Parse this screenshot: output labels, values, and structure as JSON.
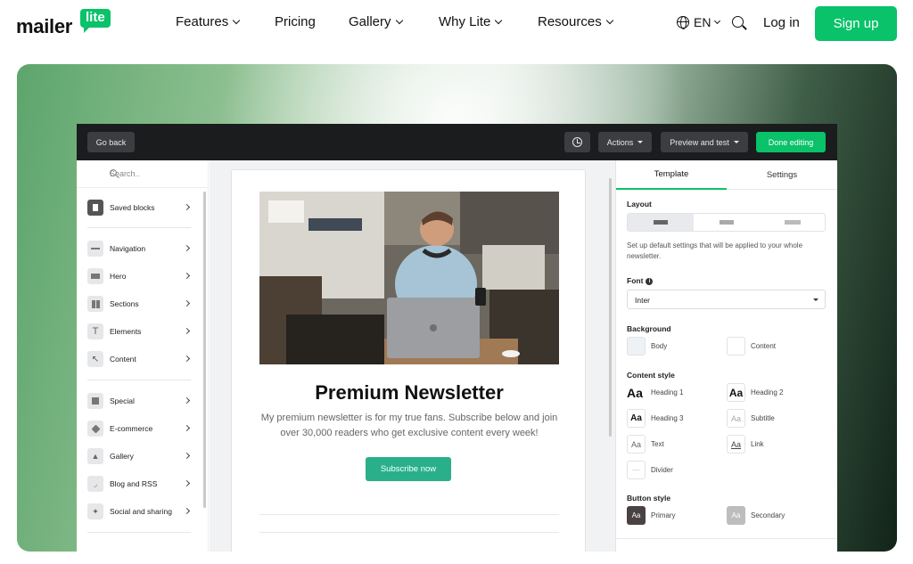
{
  "site": {
    "logo_text": "mailer",
    "logo_bubble": "lite",
    "nav": [
      {
        "label": "Features",
        "has_dropdown": true
      },
      {
        "label": "Pricing",
        "has_dropdown": false
      },
      {
        "label": "Gallery",
        "has_dropdown": true
      },
      {
        "label": "Why Lite",
        "has_dropdown": true
      },
      {
        "label": "Resources",
        "has_dropdown": true
      }
    ],
    "lang": "EN",
    "login": "Log in",
    "signup": "Sign up",
    "brand_color": "#09c269"
  },
  "editor": {
    "go_back": "Go back",
    "actions": "Actions",
    "preview": "Preview and test",
    "done": "Done editing",
    "search_placeholder": "Search..",
    "blocks": [
      {
        "label": "Saved blocks",
        "icon": "bookmark-icon"
      },
      {
        "label": "Navigation",
        "icon": "navigation-icon"
      },
      {
        "label": "Hero",
        "icon": "hero-icon"
      },
      {
        "label": "Sections",
        "icon": "sections-icon"
      },
      {
        "label": "Elements",
        "icon": "text-icon"
      },
      {
        "label": "Content",
        "icon": "cursor-icon"
      },
      {
        "label": "Special",
        "icon": "special-icon"
      },
      {
        "label": "E-commerce",
        "icon": "tag-icon"
      },
      {
        "label": "Gallery",
        "icon": "image-icon"
      },
      {
        "label": "Blog and RSS",
        "icon": "rss-icon"
      },
      {
        "label": "Social and sharing",
        "icon": "twitter-icon"
      }
    ],
    "newsletter": {
      "title": "Premium Newsletter",
      "description": "My premium newsletter is for my true fans. Subscribe below and join over 30,000 readers who get exclusive content every week!",
      "button": "Subscribe now",
      "button_color": "#29b08a"
    },
    "panel": {
      "tabs": [
        "Template",
        "Settings"
      ],
      "layout_heading": "Layout",
      "layout_help": "Set up default settings that will be applied to your whole newsletter.",
      "font_heading": "Font",
      "font_value": "Inter",
      "background_heading": "Background",
      "background": [
        "Body",
        "Content"
      ],
      "content_style_heading": "Content style",
      "styles": [
        {
          "sample": "Aa",
          "label": "Heading 1"
        },
        {
          "sample": "Aa",
          "label": "Heading 2"
        },
        {
          "sample": "Aa",
          "label": "Heading 3"
        },
        {
          "sample": "Aa",
          "label": "Subtitle"
        },
        {
          "sample": "Aa",
          "label": "Text"
        },
        {
          "sample": "Aa",
          "label": "Link"
        },
        {
          "sample": "—",
          "label": "Divider"
        }
      ],
      "button_style_heading": "Button style",
      "buttons": [
        {
          "sample": "Aa",
          "label": "Primary"
        },
        {
          "sample": "Aa",
          "label": "Secondary"
        }
      ]
    }
  }
}
